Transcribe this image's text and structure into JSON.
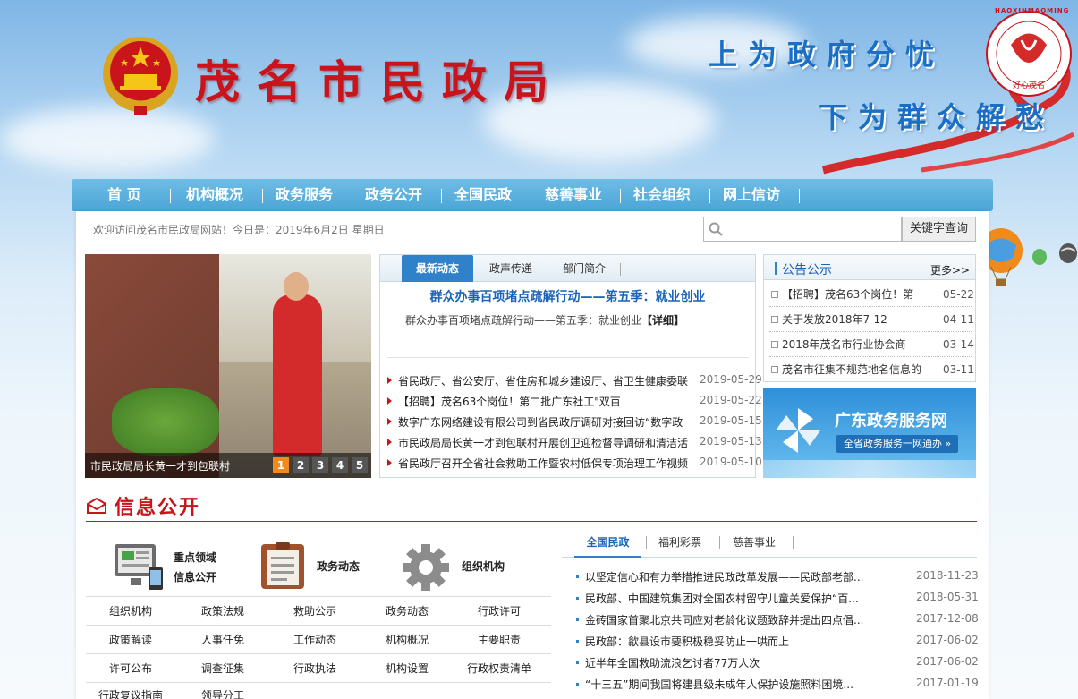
{
  "header": {
    "site_title": "茂名市民政局",
    "slogan_top": "上为政府分忧",
    "slogan_bottom": "下为群众解愁",
    "logo_ring_text": "HAOXINMAOMING",
    "logo_caption": "好心茂名"
  },
  "nav": {
    "items": [
      "首 页",
      "机构概况",
      "政务服务",
      "政务公开",
      "全国民政",
      "慈善事业",
      "社会组织",
      "网上信访"
    ]
  },
  "welcome_text": "欢迎访问茂名市民政局网站！今日是：2019年6月2日 星期日",
  "search": {
    "placeholder": "",
    "button_label": "关键字查询"
  },
  "slideshow": {
    "caption": "市民政局局长黄一才到包联村",
    "pages": [
      "1",
      "2",
      "3",
      "4",
      "5"
    ],
    "active_page": 1
  },
  "news": {
    "tabs": [
      "最新动态",
      "政声传递",
      "部门简介"
    ],
    "lead_title": "群众办事百项堵点疏解行动——第五季：就业创业",
    "lead_summary": "群众办事百项堵点疏解行动——第五季：就业创业",
    "lead_more": "【详细】",
    "items": [
      {
        "title": "省民政厅、省公安厅、省住房和城乡建设厅、省卫生健康委联",
        "date": "2019-05-29"
      },
      {
        "title": "【招聘】茂名63个岗位！第二批广东社工\"双百",
        "date": "2019-05-22"
      },
      {
        "title": "数字广东网络建设有限公司到省民政厅调研对接回访“数字政",
        "date": "2019-05-15"
      },
      {
        "title": "市民政局局长黄一才到包联村开展创卫迎检督导调研和清洁活",
        "date": "2019-05-13"
      },
      {
        "title": "省民政厅召开全省社会救助工作暨农村低保专项治理工作视频",
        "date": "2019-05-10"
      }
    ]
  },
  "notices": {
    "title": "公告公示",
    "more_label": "更多>>",
    "items": [
      {
        "title": "【招聘】茂名63个岗位！第",
        "date": "05-22"
      },
      {
        "title": "关于发放2018年7-12",
        "date": "04-11"
      },
      {
        "title": "2018年茂名市行业协会商",
        "date": "03-14"
      },
      {
        "title": "茂名市征集不规范地名信息的",
        "date": "03-11"
      }
    ]
  },
  "gd_banner": {
    "title": "广东政务服务网",
    "subtitle": "全省政务服务一网通办 »"
  },
  "info_section": {
    "title": "信息公开",
    "icon_blocks": [
      {
        "label_line1": "重点领域",
        "label_line2": "信息公开"
      },
      {
        "label_line1": "政务动态",
        "label_line2": ""
      },
      {
        "label_line1": "组织机构",
        "label_line2": ""
      }
    ],
    "links": [
      [
        "组织机构",
        "政策法规",
        "救助公示",
        "政务动态",
        "行政许可"
      ],
      [
        "政策解读",
        "人事任免",
        "工作动态",
        "机构概况",
        "主要职责"
      ],
      [
        "许可公布",
        "调查征集",
        "行政执法",
        "机构设置",
        "行政权责清单"
      ],
      [
        "行政复议指南",
        "领导分工",
        "",
        "",
        ""
      ]
    ]
  },
  "right_news": {
    "tabs": [
      "全国民政",
      "福利彩票",
      "慈善事业"
    ],
    "items": [
      {
        "title": "以坚定信心和有力举措推进民政改革发展——民政部老部...",
        "date": "2018-11-23"
      },
      {
        "title": "民政部、中国建筑集团对全国农村留守儿童关爱保护“百...",
        "date": "2018-05-31"
      },
      {
        "title": "金砖国家首聚北京共同应对老龄化议题致辞并提出四点倡...",
        "date": "2017-12-08"
      },
      {
        "title": "民政部：歙县设市要积极稳妥防止一哄而上",
        "date": "2017-06-02"
      },
      {
        "title": "近半年全国救助流浪乞讨者77万人次",
        "date": "2017-06-02"
      },
      {
        "title": "“十三五”期间我国将建县级未成年人保护设施照料困境...",
        "date": "2017-01-19"
      }
    ]
  },
  "colors": {
    "accent_red": "#c8141a",
    "nav_blue": "#4aa5d6",
    "tab_blue": "#2f81c9"
  }
}
